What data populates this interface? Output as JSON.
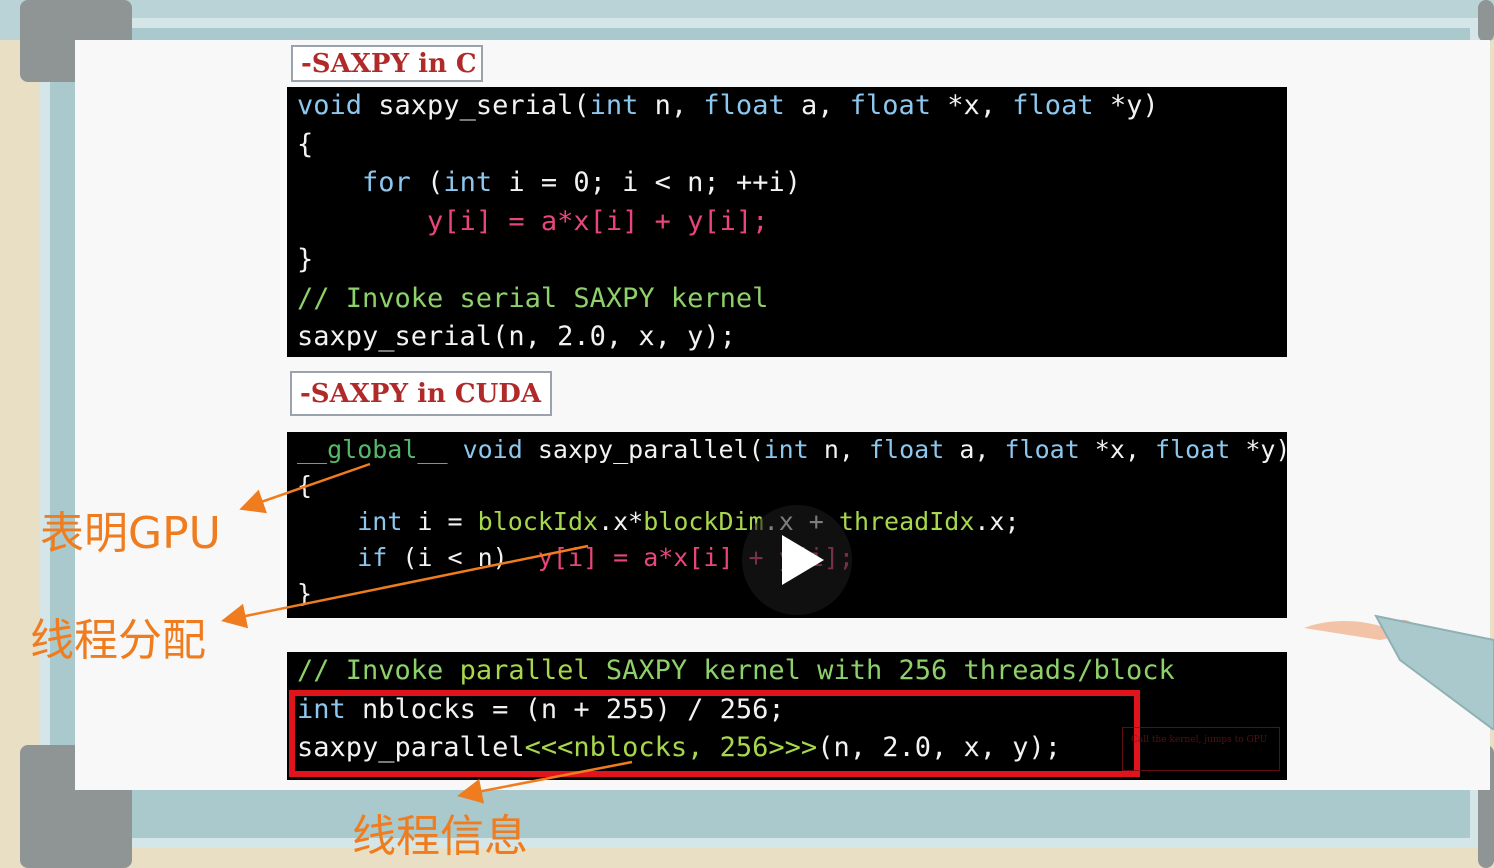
{
  "slide": {
    "c_section": {
      "title": "-SAXPY in C"
    },
    "cuda_section": {
      "title": "-SAXPY in CUDA"
    },
    "c_code": [
      [
        {
          "t": "void",
          "c": "kw"
        },
        {
          "t": " saxpy_serial(",
          "c": ""
        },
        {
          "t": "int",
          "c": "kw"
        },
        {
          "t": " n, ",
          "c": ""
        },
        {
          "t": "float",
          "c": "kw"
        },
        {
          "t": " a, ",
          "c": ""
        },
        {
          "t": "float",
          "c": "kw"
        },
        {
          "t": " *x, ",
          "c": ""
        },
        {
          "t": "float",
          "c": "kw"
        },
        {
          "t": " *y)",
          "c": ""
        }
      ],
      [
        {
          "t": "{",
          "c": ""
        }
      ],
      [
        {
          "t": "    ",
          "c": ""
        },
        {
          "t": "for",
          "c": "kw"
        },
        {
          "t": " (",
          "c": ""
        },
        {
          "t": "int",
          "c": "kw"
        },
        {
          "t": " i = 0; i < n; ++i)",
          "c": ""
        }
      ],
      [
        {
          "t": "        ",
          "c": ""
        },
        {
          "t": "y[i] = a*x[i] + y[i];",
          "c": "red"
        }
      ],
      [
        {
          "t": "}",
          "c": ""
        }
      ],
      [
        {
          "t": "// Invoke serial SAXPY kernel",
          "c": "cmt"
        }
      ],
      [
        {
          "t": "saxpy_serial(n, 2.0, x, y);",
          "c": ""
        }
      ]
    ],
    "cuda_code": [
      [
        {
          "t": "__global__",
          "c": "dgreen"
        },
        {
          "t": " ",
          "c": ""
        },
        {
          "t": "void",
          "c": "kw"
        },
        {
          "t": " saxpy_parallel(",
          "c": ""
        },
        {
          "t": "int",
          "c": "kw"
        },
        {
          "t": " n, ",
          "c": ""
        },
        {
          "t": "float",
          "c": "kw"
        },
        {
          "t": " a, ",
          "c": ""
        },
        {
          "t": "float",
          "c": "kw"
        },
        {
          "t": " *x, ",
          "c": ""
        },
        {
          "t": "float",
          "c": "kw"
        },
        {
          "t": " *y)",
          "c": ""
        }
      ],
      [
        {
          "t": "{",
          "c": ""
        }
      ],
      [
        {
          "t": "    ",
          "c": ""
        },
        {
          "t": "int",
          "c": "kw"
        },
        {
          "t": " i = ",
          "c": ""
        },
        {
          "t": "blockIdx",
          "c": "green"
        },
        {
          "t": ".x*",
          "c": ""
        },
        {
          "t": "blockDim",
          "c": "green"
        },
        {
          "t": ".x + ",
          "c": ""
        },
        {
          "t": "threadIdx",
          "c": "green"
        },
        {
          "t": ".x;",
          "c": ""
        }
      ],
      [
        {
          "t": "    ",
          "c": ""
        },
        {
          "t": "if",
          "c": "kw"
        },
        {
          "t": " (i < n)  ",
          "c": ""
        },
        {
          "t": "y[i] = a*x[i] + y[i];",
          "c": "red"
        }
      ],
      [
        {
          "t": "}",
          "c": ""
        }
      ]
    ],
    "invoke_code": [
      [
        {
          "t": "// Invoke ",
          "c": "cmt"
        },
        {
          "t": "parallel",
          "c": "green"
        },
        {
          "t": " SAXPY kernel with 256 threads/block",
          "c": "cmt"
        }
      ],
      [
        {
          "t": "int",
          "c": "kw"
        },
        {
          "t": " nblocks = (n + 255) / 256;",
          "c": ""
        }
      ],
      [
        {
          "t": "saxpy_parallel",
          "c": ""
        },
        {
          "t": "<<<nblocks, 256>>>",
          "c": "green"
        },
        {
          "t": "(n, 2.0, x, y);",
          "c": ""
        }
      ]
    ],
    "side_note": "Call the kernel, jumps to GPU"
  },
  "annotations": {
    "gpu": "表明GPU",
    "thread_alloc": "线程分配",
    "thread_info": "线程信息"
  },
  "colors": {
    "annotation": "#ef7c1e",
    "highlight_box": "#e0141c",
    "keyword": "#8ec7ee",
    "expression": "#e8467a",
    "cuda_builtin": "#a7d74c"
  },
  "player": {
    "play_icon": "play-icon"
  }
}
